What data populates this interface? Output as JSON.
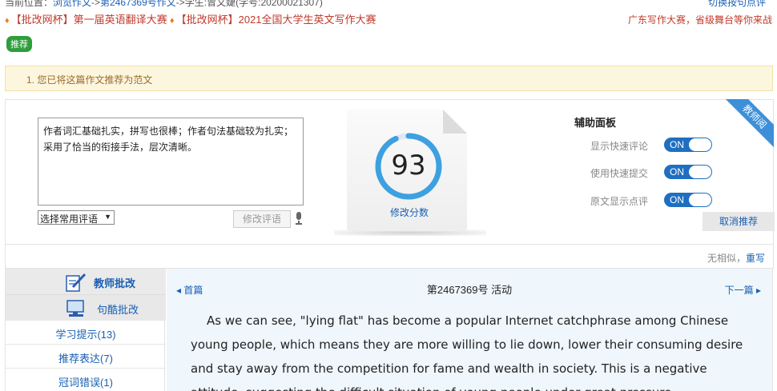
{
  "breadcrumb": {
    "prefix": "当前位置：",
    "browse": "浏览作文",
    "sep1": "->",
    "essay_link": "第2467369号作文",
    "sep2": "->",
    "student": "学生:曾文婕(学号:20200021307)",
    "switch": "切换按句点评"
  },
  "contests": {
    "item1": "【批改网杯】第一届英语翻译大赛",
    "item2": "【批改网杯】2021全国大学生英文写作大赛",
    "right": "广东写作大赛，省级舞台等你来战"
  },
  "badge": "推荐",
  "notice": "1. 您已将这篇作文推荐为范文",
  "comment": {
    "text": "作者词汇基础扎实，拼写也很棒；作者句法基础较为扎实；采用了恰当的衔接手法，层次清晰。",
    "select_label": "选择常用评语",
    "modify_button": "修改评语"
  },
  "score": {
    "value": "93",
    "modify_label": "修改分数",
    "fraction": 0.93
  },
  "aux_panel": {
    "title": "辅助面板",
    "rows": [
      {
        "label": "显示快速评论",
        "state": "ON"
      },
      {
        "label": "使用快速提交",
        "state": "ON"
      },
      {
        "label": "原文显示点评",
        "state": "ON"
      }
    ],
    "cancel": "取消推荐",
    "ribbon": "教师阅"
  },
  "similar": {
    "text": "无相似，",
    "link": "重写"
  },
  "sidebar": {
    "tab1": "教师批改",
    "tab2": "句酷批改",
    "items": [
      "学习提示(13)",
      "推荐表达(7)",
      "冠词错误(1)"
    ]
  },
  "essay": {
    "first": "◂ 首篇",
    "next": "下一篇 ▸",
    "title": "第2467369号 活动",
    "body": "As we can see, \"lying flat\" has become a popular Internet catchphrase among Chinese young people, which means they are more willing to lie down, lower their consuming desire and stay away from the competition for fame and wealth in society. This is a negative attitude, suggesting the difficult situation of young people under great pressure."
  },
  "colors": {
    "accent": "#1a5fb4",
    "toggle": "#1f6fc1",
    "score_ring": "#3da0e0",
    "badge": "#2e9e3a",
    "contest_red": "#c0392b",
    "notice_bg": "#fcf6df"
  }
}
